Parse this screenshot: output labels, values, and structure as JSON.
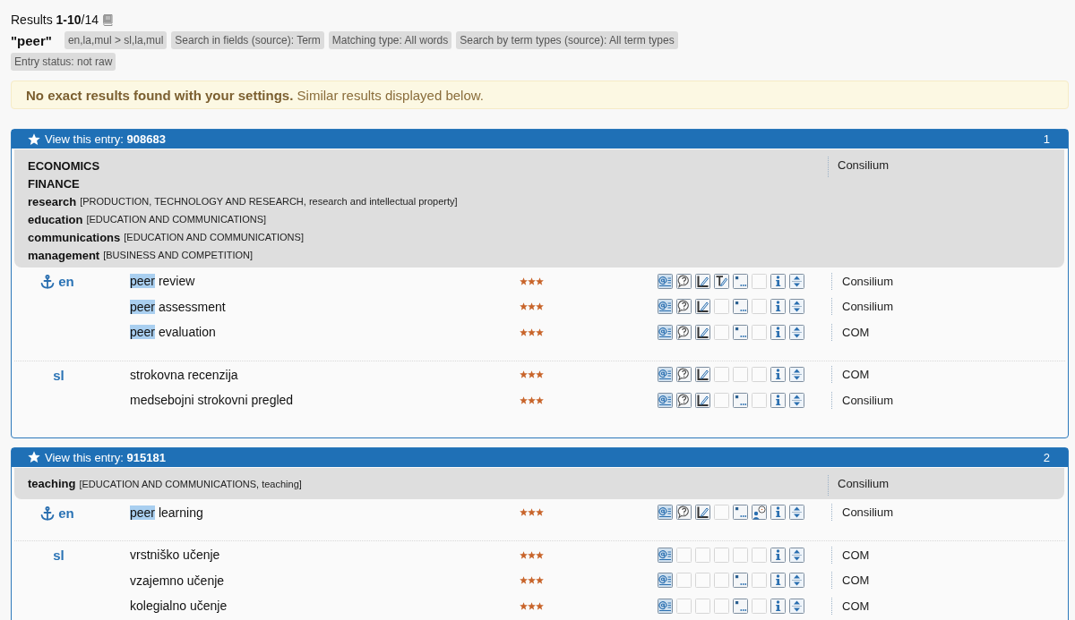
{
  "summary": "Results **1-10**/14",
  "query": "\"peer\"",
  "search_filters": [
    "en,la,mul > sl,la,mul",
    "Search in fields (source): Term",
    "Matching type: All words",
    "Search by term types (source): All term types"
  ],
  "entry_filters": [
    "Entry status: not raw"
  ],
  "notice": "**No exact results found with your settings.** Similar results displayed below.",
  "entries": [
    {
      "link": "View this entry: **908683**",
      "number": "1",
      "domains": [
        {
          "name": "ECONOMICS"
        },
        {
          "name": "FINANCE"
        },
        {
          "name": "research",
          "path": "[PRODUCTION, TECHNOLOGY AND RESEARCH, research and intellectual property]"
        },
        {
          "name": "education",
          "path": "[EDUCATION AND COMMUNICATIONS]"
        },
        {
          "name": "communications",
          "path": "[EDUCATION AND COMMUNICATIONS]"
        },
        {
          "name": "management",
          "path": "[BUSINESS AND COMPETITION]"
        }
      ],
      "source": "Consilium",
      "languages": [
        {
          "code": "en",
          "anchor": true,
          "terms": [
            {
              "parts": [
                {
                  "text": "peer",
                  "highlighted": true
                },
                {
                  "text": " review",
                  "highlighted": false
                }
              ],
              "stars": 3,
              "icons": [
                {
                  "kind": "at"
                },
                {
                  "kind": "question"
                },
                {
                  "kind": "pen"
                },
                {
                  "kind": "text-pen"
                },
                {
                  "kind": "quote"
                },
                {
                  "kind": "empty"
                },
                {
                  "kind": "person"
                },
                {
                  "kind": "arrows"
                }
              ],
              "source": "Consilium"
            },
            {
              "parts": [
                {
                  "text": "peer",
                  "highlighted": true
                },
                {
                  "text": " assessment",
                  "highlighted": false
                }
              ],
              "stars": 3,
              "icons": [
                {
                  "kind": "at"
                },
                {
                  "kind": "question"
                },
                {
                  "kind": "pen"
                },
                {
                  "kind": "empty"
                },
                {
                  "kind": "quote"
                },
                {
                  "kind": "empty"
                },
                {
                  "kind": "person"
                },
                {
                  "kind": "arrows"
                }
              ],
              "source": "Consilium"
            },
            {
              "parts": [
                {
                  "text": "peer",
                  "highlighted": true
                },
                {
                  "text": " evaluation",
                  "highlighted": false
                }
              ],
              "stars": 3,
              "icons": [
                {
                  "kind": "at"
                },
                {
                  "kind": "question"
                },
                {
                  "kind": "pen"
                },
                {
                  "kind": "empty"
                },
                {
                  "kind": "quote"
                },
                {
                  "kind": "empty"
                },
                {
                  "kind": "person"
                },
                {
                  "kind": "arrows"
                }
              ],
              "source": "COM"
            }
          ]
        },
        {
          "code": "sl",
          "anchor": false,
          "terms": [
            {
              "parts": [
                {
                  "text": "strokovna recenzija",
                  "highlighted": false
                }
              ],
              "stars": 3,
              "icons": [
                {
                  "kind": "at"
                },
                {
                  "kind": "question"
                },
                {
                  "kind": "pen"
                },
                {
                  "kind": "empty"
                },
                {
                  "kind": "empty"
                },
                {
                  "kind": "empty"
                },
                {
                  "kind": "person"
                },
                {
                  "kind": "arrows"
                }
              ],
              "source": "COM"
            },
            {
              "parts": [
                {
                  "text": "medsebojni strokovni pregled",
                  "highlighted": false
                }
              ],
              "stars": 3,
              "icons": [
                {
                  "kind": "at"
                },
                {
                  "kind": "question"
                },
                {
                  "kind": "pen"
                },
                {
                  "kind": "empty"
                },
                {
                  "kind": "quote"
                },
                {
                  "kind": "empty"
                },
                {
                  "kind": "person"
                },
                {
                  "kind": "arrows"
                }
              ],
              "source": "Consilium"
            }
          ]
        }
      ]
    },
    {
      "link": "View this entry: **915181**",
      "number": "2",
      "domains": [
        {
          "name": "teaching",
          "path": "[EDUCATION AND COMMUNICATIONS, teaching]"
        }
      ],
      "source": "Consilium",
      "languages": [
        {
          "code": "en",
          "anchor": true,
          "terms": [
            {
              "parts": [
                {
                  "text": "peer",
                  "highlighted": true
                },
                {
                  "text": " learning",
                  "highlighted": false
                }
              ],
              "stars": 3,
              "icons": [
                {
                  "kind": "at"
                },
                {
                  "kind": "question"
                },
                {
                  "kind": "pen"
                },
                {
                  "kind": "empty"
                },
                {
                  "kind": "quote"
                },
                {
                  "kind": "person-bubble"
                },
                {
                  "kind": "person"
                },
                {
                  "kind": "arrows"
                }
              ],
              "source": "Consilium"
            }
          ]
        },
        {
          "code": "sl",
          "anchor": false,
          "terms": [
            {
              "parts": [
                {
                  "text": "vrstniško učenje",
                  "highlighted": false
                }
              ],
              "stars": 3,
              "icons": [
                {
                  "kind": "at"
                },
                {
                  "kind": "empty"
                },
                {
                  "kind": "empty"
                },
                {
                  "kind": "empty"
                },
                {
                  "kind": "empty"
                },
                {
                  "kind": "empty"
                },
                {
                  "kind": "person"
                },
                {
                  "kind": "arrows"
                }
              ],
              "source": "COM"
            },
            {
              "parts": [
                {
                  "text": "vzajemno učenje",
                  "highlighted": false
                }
              ],
              "stars": 3,
              "icons": [
                {
                  "kind": "at"
                },
                {
                  "kind": "empty"
                },
                {
                  "kind": "empty"
                },
                {
                  "kind": "empty"
                },
                {
                  "kind": "quote"
                },
                {
                  "kind": "empty"
                },
                {
                  "kind": "person"
                },
                {
                  "kind": "arrows"
                }
              ],
              "source": "COM"
            },
            {
              "parts": [
                {
                  "text": "kolegialno učenje",
                  "highlighted": false
                }
              ],
              "stars": 3,
              "icons": [
                {
                  "kind": "at"
                },
                {
                  "kind": "empty"
                },
                {
                  "kind": "empty"
                },
                {
                  "kind": "empty"
                },
                {
                  "kind": "quote"
                },
                {
                  "kind": "empty"
                },
                {
                  "kind": "person"
                },
                {
                  "kind": "arrows"
                }
              ],
              "source": "COM"
            }
          ]
        }
      ]
    }
  ]
}
